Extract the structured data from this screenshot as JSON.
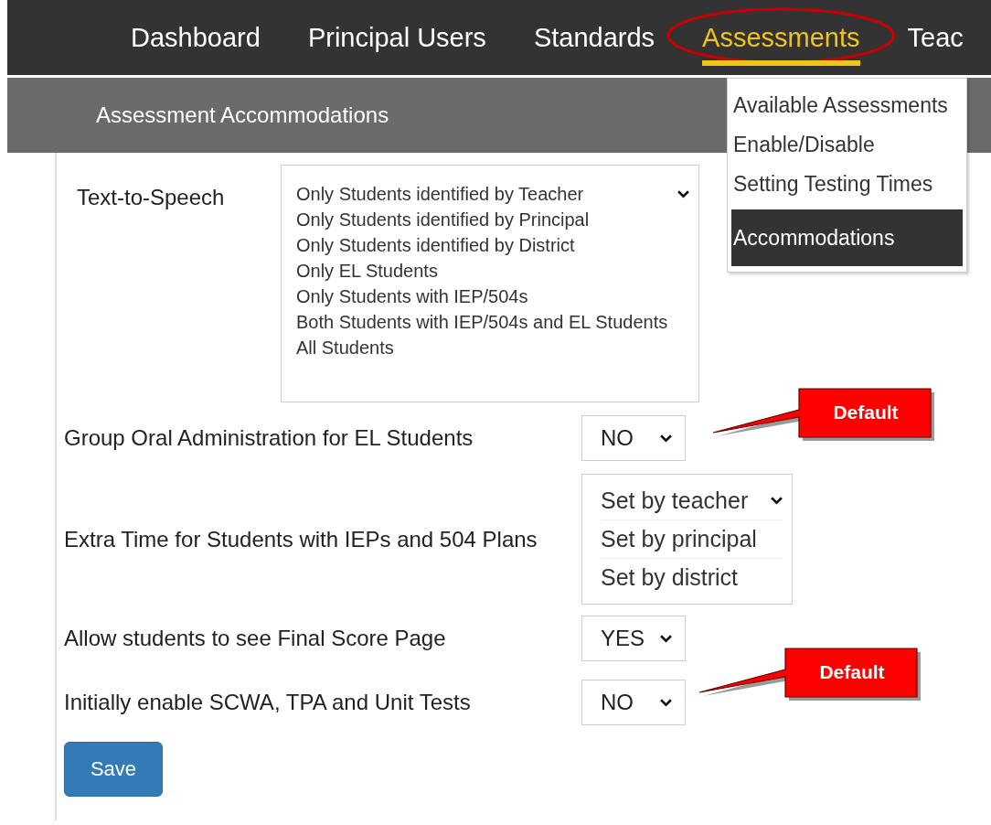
{
  "nav": {
    "items": [
      {
        "label": "Dashboard",
        "selected": false,
        "highlighted": false
      },
      {
        "label": "Principal Users",
        "selected": false,
        "highlighted": false
      },
      {
        "label": "Standards",
        "selected": false,
        "highlighted": false
      },
      {
        "label": "Assessments",
        "selected": true,
        "highlighted": true
      },
      {
        "label": "Teac",
        "selected": false,
        "highlighted": false
      }
    ]
  },
  "subheader": {
    "title": "Assessment Accommodations"
  },
  "menu": {
    "items": [
      {
        "label": "Available Assessments",
        "selected": false
      },
      {
        "label": "Enable/Disable",
        "selected": false
      },
      {
        "label": "Setting Testing Times",
        "selected": false
      },
      {
        "label": "Accommodations",
        "selected": true
      }
    ]
  },
  "settings": [
    {
      "kind": "listbox",
      "label": "Text-to-Speech",
      "options": [
        "Only Students identified by Teacher",
        "Only Students identified by Principal",
        "Only Students identified by District",
        "Only EL Students",
        "Only Students with IEP/504s",
        "Both Students with IEP/504s and EL Students",
        "All Students"
      ]
    },
    {
      "kind": "select",
      "label": "Group Oral Administration for EL Students",
      "value": "NO"
    },
    {
      "kind": "listbox",
      "label": "Extra Time for Students with IEPs and 504 Plans",
      "options": [
        "Set by teacher",
        "Set by principal",
        "Set by district"
      ]
    },
    {
      "kind": "select",
      "label": "Allow students to see Final Score Page",
      "value": "YES"
    },
    {
      "kind": "select",
      "label": "Initially enable SCWA, TPA and Unit Tests",
      "value": "NO"
    }
  ],
  "save_button": {
    "label": "Save"
  },
  "annotations": [
    {
      "kind": "callout",
      "text": "Default"
    },
    {
      "kind": "callout",
      "text": "Default"
    }
  ]
}
